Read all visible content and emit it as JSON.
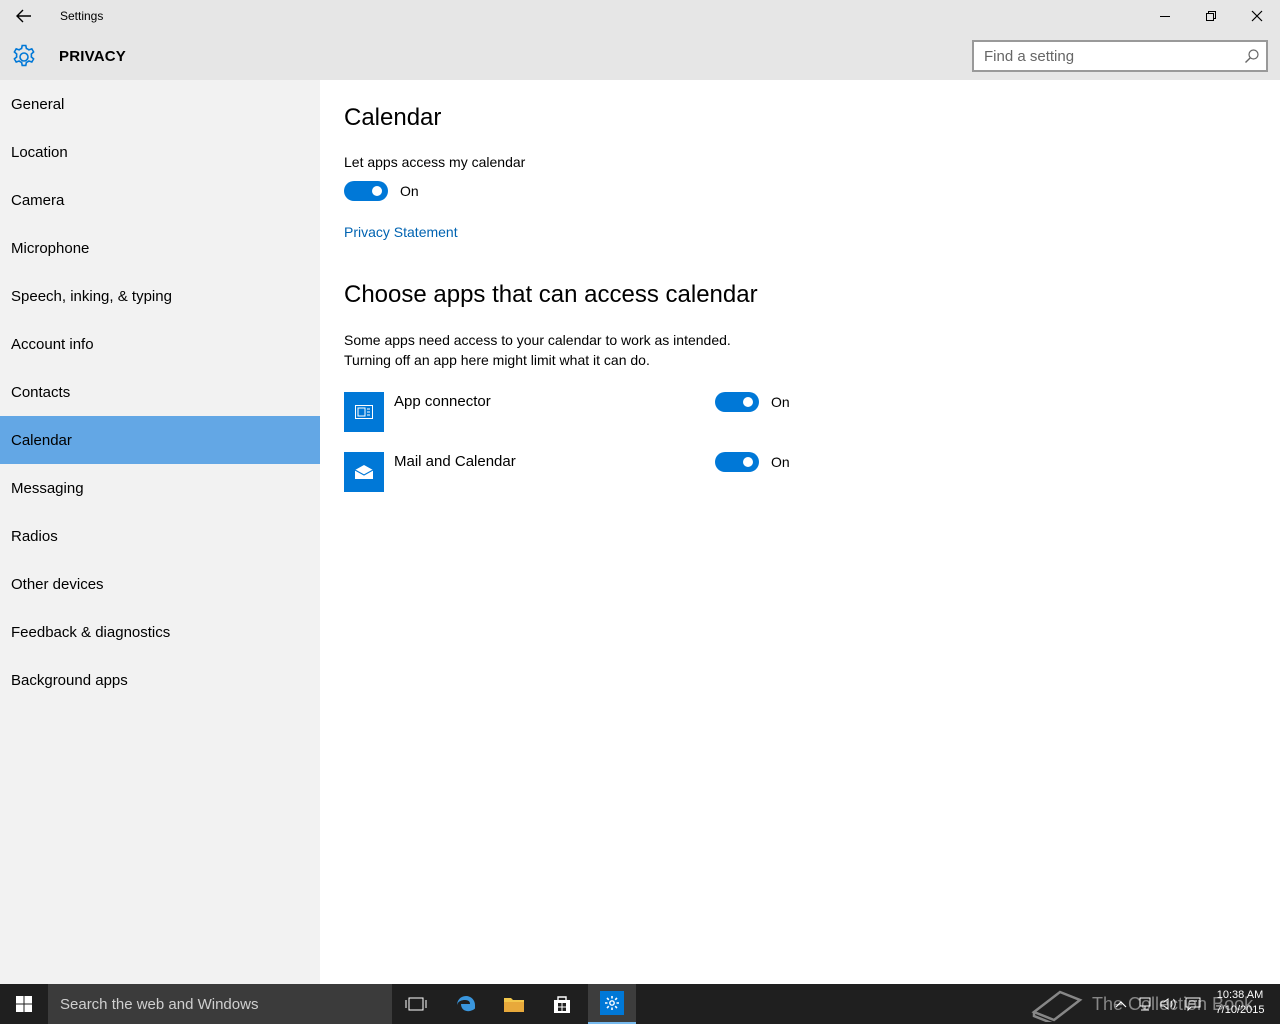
{
  "window": {
    "title": "Settings",
    "back_icon": "back-arrow-icon",
    "controls": [
      "minimize-icon",
      "restore-icon",
      "close-icon"
    ]
  },
  "header": {
    "section": "PRIVACY",
    "search_placeholder": "Find a setting",
    "accent": "#0078d7"
  },
  "sidebar": {
    "items": [
      {
        "label": "General"
      },
      {
        "label": "Location"
      },
      {
        "label": "Camera"
      },
      {
        "label": "Microphone"
      },
      {
        "label": "Speech, inking, & typing"
      },
      {
        "label": "Account info"
      },
      {
        "label": "Contacts"
      },
      {
        "label": "Calendar",
        "active": true
      },
      {
        "label": "Messaging"
      },
      {
        "label": "Radios"
      },
      {
        "label": "Other devices"
      },
      {
        "label": "Feedback & diagnostics"
      },
      {
        "label": "Background apps"
      }
    ],
    "active_color": "#63a7e5"
  },
  "main": {
    "title": "Calendar",
    "access_label": "Let apps access my calendar",
    "access_state": "On",
    "privacy_link": "Privacy Statement",
    "apps_title": "Choose apps that can access calendar",
    "description_line1": "Some apps need access to your calendar to work as intended.",
    "description_line2": "Turning off an app here might limit what it can do.",
    "apps": [
      {
        "name": "App connector",
        "state": "On",
        "icon": "app-connector-icon"
      },
      {
        "name": "Mail and Calendar",
        "state": "On",
        "icon": "mail-envelope-icon"
      }
    ]
  },
  "taskbar": {
    "search_placeholder": "Search the web and Windows",
    "watermark": "The Collection Book",
    "time": "10:38 AM",
    "date": "7/10/2015"
  }
}
